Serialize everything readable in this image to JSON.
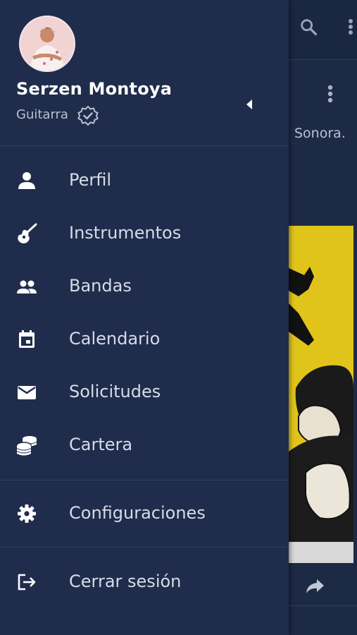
{
  "user": {
    "name": "Serzen Montoya",
    "instrument": "Guitarra"
  },
  "menu": {
    "items": [
      {
        "label": "Perfil",
        "icon": "person-icon"
      },
      {
        "label": "Instrumentos",
        "icon": "guitar-icon"
      },
      {
        "label": "Bandas",
        "icon": "group-icon"
      },
      {
        "label": "Calendario",
        "icon": "calendar-icon"
      },
      {
        "label": "Solicitudes",
        "icon": "mail-icon"
      },
      {
        "label": "Cartera",
        "icon": "coins-icon"
      }
    ],
    "settings": {
      "label": "Configuraciones",
      "icon": "gear-icon"
    },
    "logout": {
      "label": "Cerrar sesión",
      "icon": "logout-icon"
    }
  },
  "background": {
    "snippet": "Sonora."
  },
  "colors": {
    "drawer": "#202c4c",
    "background": "#1d2a45",
    "poster": "#e0c41a",
    "text": "#d6dce6"
  }
}
